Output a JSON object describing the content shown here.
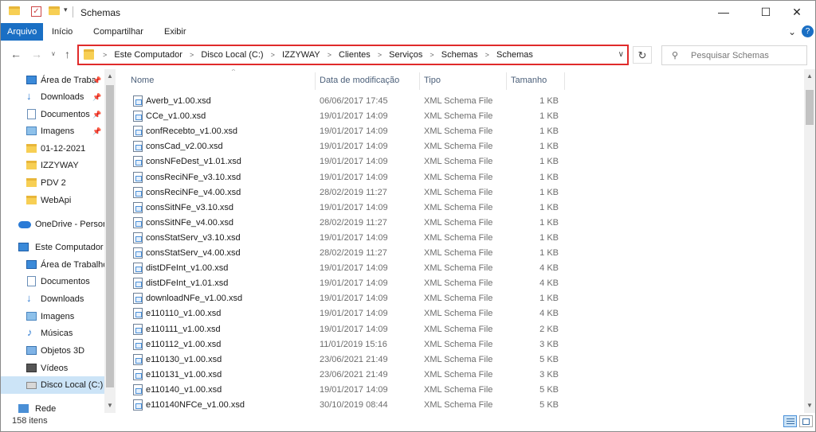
{
  "window": {
    "title": "Schemas",
    "minimize": "—",
    "maximize": "☐",
    "close": "✕"
  },
  "ribbon": {
    "tabs": [
      "Arquivo",
      "Início",
      "Compartilhar",
      "Exibir"
    ],
    "expand": "⌄",
    "help": "?"
  },
  "address": {
    "crumbs": [
      "Este Computador",
      "Disco Local (C:)",
      "IZZYWAY",
      "Clientes",
      "Serviços",
      "Schemas",
      "Schemas"
    ],
    "search_placeholder": "Pesquisar Schemas",
    "highlight_color": "#e02b2b"
  },
  "nav": {
    "quick_access": [
      {
        "label": "Área de Traba",
        "icon": "desktop-icon",
        "pinned": true
      },
      {
        "label": "Downloads",
        "icon": "download-icon",
        "pinned": true
      },
      {
        "label": "Documentos",
        "icon": "documents-icon",
        "pinned": true
      },
      {
        "label": "Imagens",
        "icon": "pictures-icon",
        "pinned": true
      },
      {
        "label": "01-12-2021",
        "icon": "folder-icon",
        "pinned": false
      },
      {
        "label": "IZZYWAY",
        "icon": "folder-icon",
        "pinned": false
      },
      {
        "label": "PDV 2",
        "icon": "folder-icon",
        "pinned": false
      },
      {
        "label": "WebApi",
        "icon": "folder-icon",
        "pinned": false
      }
    ],
    "onedrive": {
      "label": "OneDrive - Persor",
      "icon": "cloud-icon"
    },
    "this_pc": {
      "label": "Este Computador",
      "icon": "computer-icon"
    },
    "pc_items": [
      {
        "label": "Área de Trabalho",
        "icon": "desktop-icon"
      },
      {
        "label": "Documentos",
        "icon": "documents-icon"
      },
      {
        "label": "Downloads",
        "icon": "download-icon"
      },
      {
        "label": "Imagens",
        "icon": "pictures-icon"
      },
      {
        "label": "Músicas",
        "icon": "music-icon"
      },
      {
        "label": "Objetos 3D",
        "icon": "3d-objects-icon"
      },
      {
        "label": "Vídeos",
        "icon": "videos-icon"
      },
      {
        "label": "Disco Local (C:)",
        "icon": "drive-icon",
        "selected": true
      }
    ],
    "network": {
      "label": "Rede",
      "icon": "network-icon"
    }
  },
  "columns": {
    "name": "Nome",
    "date": "Data de modificação",
    "type": "Tipo",
    "size": "Tamanho"
  },
  "files": [
    {
      "name": "Averb_v1.00.xsd",
      "date": "06/06/2017 17:45",
      "type": "XML Schema File",
      "size": "1 KB"
    },
    {
      "name": "CCe_v1.00.xsd",
      "date": "19/01/2017 14:09",
      "type": "XML Schema File",
      "size": "1 KB"
    },
    {
      "name": "confRecebto_v1.00.xsd",
      "date": "19/01/2017 14:09",
      "type": "XML Schema File",
      "size": "1 KB"
    },
    {
      "name": "consCad_v2.00.xsd",
      "date": "19/01/2017 14:09",
      "type": "XML Schema File",
      "size": "1 KB"
    },
    {
      "name": "consNFeDest_v1.01.xsd",
      "date": "19/01/2017 14:09",
      "type": "XML Schema File",
      "size": "1 KB"
    },
    {
      "name": "consReciNFe_v3.10.xsd",
      "date": "19/01/2017 14:09",
      "type": "XML Schema File",
      "size": "1 KB"
    },
    {
      "name": "consReciNFe_v4.00.xsd",
      "date": "28/02/2019 11:27",
      "type": "XML Schema File",
      "size": "1 KB"
    },
    {
      "name": "consSitNFe_v3.10.xsd",
      "date": "19/01/2017 14:09",
      "type": "XML Schema File",
      "size": "1 KB"
    },
    {
      "name": "consSitNFe_v4.00.xsd",
      "date": "28/02/2019 11:27",
      "type": "XML Schema File",
      "size": "1 KB"
    },
    {
      "name": "consStatServ_v3.10.xsd",
      "date": "19/01/2017 14:09",
      "type": "XML Schema File",
      "size": "1 KB"
    },
    {
      "name": "consStatServ_v4.00.xsd",
      "date": "28/02/2019 11:27",
      "type": "XML Schema File",
      "size": "1 KB"
    },
    {
      "name": "distDFeInt_v1.00.xsd",
      "date": "19/01/2017 14:09",
      "type": "XML Schema File",
      "size": "4 KB"
    },
    {
      "name": "distDFeInt_v1.01.xsd",
      "date": "19/01/2017 14:09",
      "type": "XML Schema File",
      "size": "4 KB"
    },
    {
      "name": "downloadNFe_v1.00.xsd",
      "date": "19/01/2017 14:09",
      "type": "XML Schema File",
      "size": "1 KB"
    },
    {
      "name": "e110110_v1.00.xsd",
      "date": "19/01/2017 14:09",
      "type": "XML Schema File",
      "size": "4 KB"
    },
    {
      "name": "e110111_v1.00.xsd",
      "date": "19/01/2017 14:09",
      "type": "XML Schema File",
      "size": "2 KB"
    },
    {
      "name": "e110112_v1.00.xsd",
      "date": "11/01/2019 15:16",
      "type": "XML Schema File",
      "size": "3 KB"
    },
    {
      "name": "e110130_v1.00.xsd",
      "date": "23/06/2021 21:49",
      "type": "XML Schema File",
      "size": "5 KB"
    },
    {
      "name": "e110131_v1.00.xsd",
      "date": "23/06/2021 21:49",
      "type": "XML Schema File",
      "size": "3 KB"
    },
    {
      "name": "e110140_v1.00.xsd",
      "date": "19/01/2017 14:09",
      "type": "XML Schema File",
      "size": "5 KB"
    },
    {
      "name": "e110140NFCe_v1.00.xsd",
      "date": "30/10/2019 08:44",
      "type": "XML Schema File",
      "size": "5 KB"
    }
  ],
  "status": {
    "item_count": "158 itens"
  }
}
